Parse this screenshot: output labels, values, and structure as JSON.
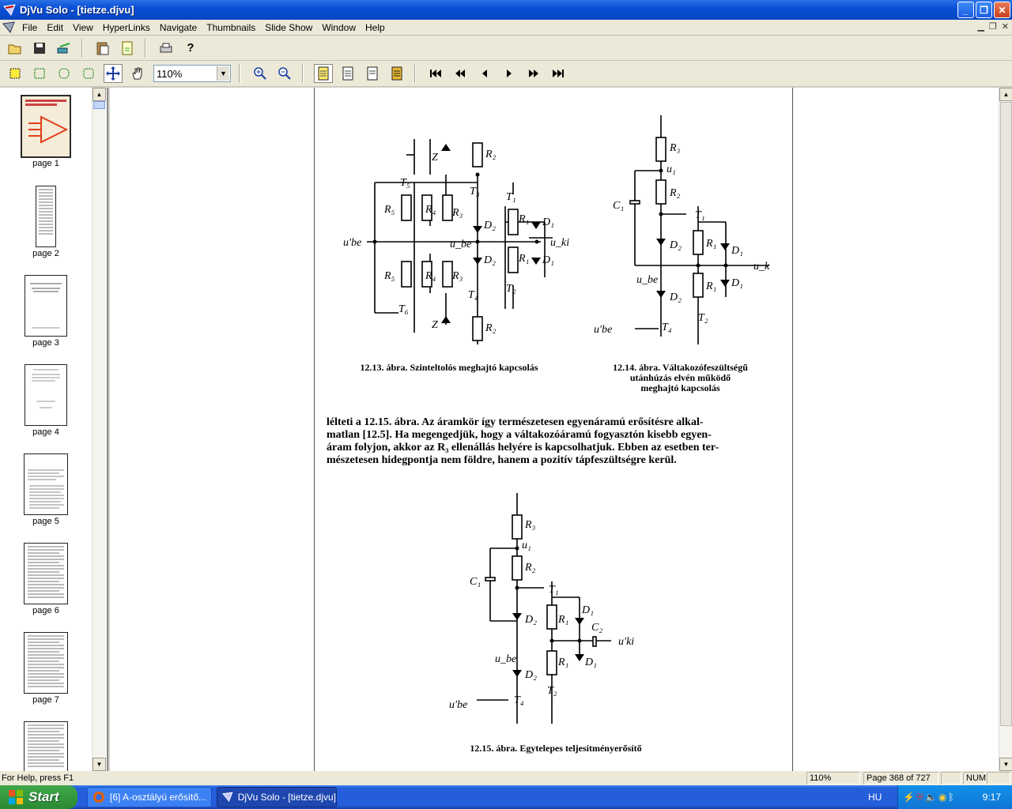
{
  "window": {
    "title": "DjVu Solo - [tietze.djvu]"
  },
  "menu": [
    "File",
    "Edit",
    "View",
    "HyperLinks",
    "Navigate",
    "Thumbnails",
    "Slide Show",
    "Window",
    "Help"
  ],
  "toolbar": {
    "zoom_value": "110%",
    "zoom_options": [
      "110%"
    ]
  },
  "thumbnails": [
    {
      "label": "page 1"
    },
    {
      "label": "page 2"
    },
    {
      "label": "page 3"
    },
    {
      "label": "page 4"
    },
    {
      "label": "page 5"
    },
    {
      "label": "page 6"
    },
    {
      "label": "page 7"
    }
  ],
  "document": {
    "fig1": {
      "caption": "12.13. ábra. Szinteltolós meghajtó kapcsolás",
      "labels": {
        "R2": "R₂",
        "R5": "R₅",
        "R4": "R₄",
        "R3": "R₃",
        "R1": "R₁",
        "T5": "T₅",
        "T3": "T₃",
        "T1": "T₁",
        "T6": "T₆",
        "T4": "T₄",
        "T2": "T₂",
        "D2": "D₂",
        "D1": "D₁",
        "Z": "Z",
        "ube": "u_be",
        "uki": "u_ki",
        "ube_in": "u′be"
      }
    },
    "fig2": {
      "caption_lines": [
        "12.14. ábra. Váltakozófeszültségű",
        "utánhúzás elvén működő",
        "meghajtó kapcsolás"
      ],
      "labels": {
        "R3": "R₃",
        "u1": "u₁",
        "R2": "R₂",
        "C1": "C₁",
        "T1": "T₁",
        "D2": "D₂",
        "R1": "R₁",
        "D1": "D₁",
        "ube": "u_be",
        "T4": "T₄",
        "T2": "T₂",
        "ube_in": "u′be",
        "uki": "u_k"
      }
    },
    "paragraph_lines": [
      "lélteti a 12.15. ábra. Az áramkör így természetesen egyenáramú erősítésre alkal-",
      "matlan [12.5]. Ha megengedjük, hogy a váltakozóáramú fogyasztón kisebb egyen-",
      "áram folyjon, akkor az R₃ ellenállás helyére is kapcsolhatjuk. Ebben az esetben ter-",
      "mészetesen hidegpontja nem földre, hanem a pozitív tápfeszültségre kerül."
    ],
    "fig3": {
      "caption": "12.15. ábra. Egytelepes teljesítményerősítő",
      "labels": {
        "R3": "R₃",
        "u1": "u₁",
        "R2": "R₂",
        "C1": "C₁",
        "T1": "T₁",
        "D1": "D₁",
        "D2": "D₂",
        "R1": "R₁",
        "C2": "C₂",
        "uki": "u′ki",
        "ube": "u_be",
        "T4": "T₄",
        "T2": "T₂",
        "ube_in": "u′be"
      }
    }
  },
  "status": {
    "help": "For Help, press F1",
    "zoom": "110%",
    "page": "Page 368 of 727",
    "num": "NUM"
  },
  "taskbar": {
    "start": "Start",
    "tasks": [
      "[6] A-osztályú erősítő...",
      "DjVu Solo - [tietze.djvu]"
    ],
    "lang": "HU",
    "clock": "9:17"
  }
}
